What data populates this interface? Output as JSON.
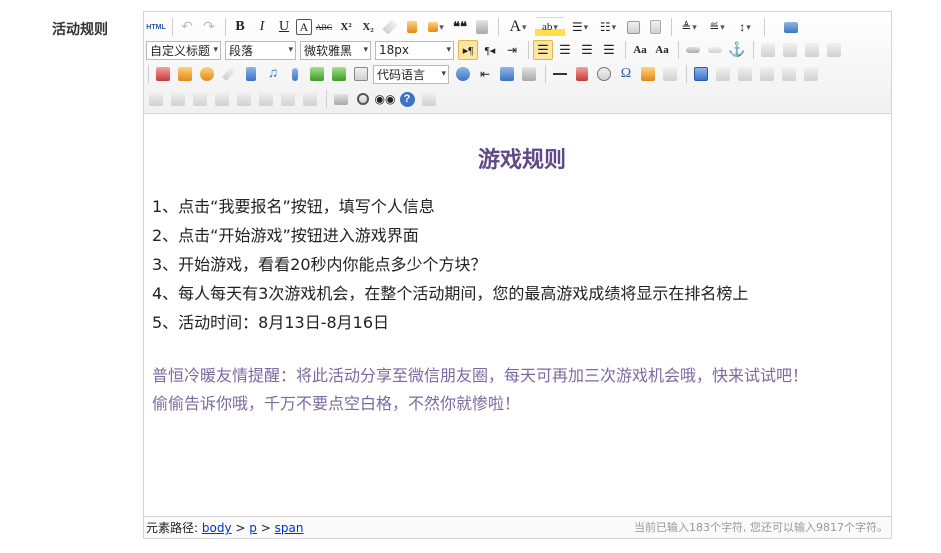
{
  "label": "活动规则",
  "toolbar": {
    "html_label": "HTML",
    "paragraph_format": "自定义标题",
    "block_style": "段落",
    "font_family": "微软雅黑",
    "font_size": "18px",
    "code_language": "代码语言",
    "bold": "B",
    "italic": "I",
    "underline": "U",
    "border": "A",
    "strike": "ABC",
    "sup": "X²",
    "sub": "X₂",
    "quote": "❝❝",
    "fontcolor": "A",
    "omega": "Ω",
    "help": "?"
  },
  "content": {
    "title": "游戏规则",
    "rules": [
      "1、点击“我要报名”按钮，填写个人信息",
      "2、点击“开始游戏”按钮进入游戏界面",
      "3、开始游戏，看看20秒内你能点多少个方块？",
      "4、每人每天有3次游戏机会，在整个活动期间，您的最高游戏成绩将显示在排名榜上",
      "5、活动时间：8月13日-8月16日"
    ],
    "tip1": "普恒冷暖友情提醒：将此活动分享至微信朋友圈，每天可再加三次游戏机会哦，快来试试吧！",
    "tip2": "偷偷告诉你哦，千万不要点空白格，不然你就惨啦！"
  },
  "status": {
    "path_label": "元素路径:",
    "path": [
      "body",
      "p",
      "span"
    ],
    "sep": ">",
    "count_text": "当前已输入183个字符, 您还可以输入9817个字符。"
  },
  "colors": {
    "title": "#5f4a87",
    "tip": "#7d68a1",
    "active": "#fbe6a4"
  }
}
